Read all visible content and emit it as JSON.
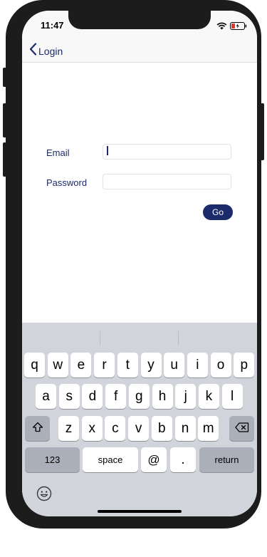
{
  "status_bar": {
    "time": "11:47"
  },
  "nav": {
    "back_label": "Login"
  },
  "form": {
    "email_label": "Email",
    "email_value": "",
    "password_label": "Password",
    "password_value": "",
    "go_label": "Go"
  },
  "keyboard": {
    "row1": [
      "q",
      "w",
      "e",
      "r",
      "t",
      "y",
      "u",
      "i",
      "o",
      "p"
    ],
    "row2": [
      "a",
      "s",
      "d",
      "f",
      "g",
      "h",
      "j",
      "k",
      "l"
    ],
    "row3": [
      "z",
      "x",
      "c",
      "v",
      "b",
      "n",
      "m"
    ],
    "numbers_label": "123",
    "space_label": "space",
    "at_label": "@",
    "dot_label": ".",
    "return_label": "return"
  },
  "icons": [
    "wifi-icon",
    "battery-charging-icon",
    "chevron-left-icon",
    "shift-icon",
    "backspace-icon",
    "emoji-icon"
  ]
}
